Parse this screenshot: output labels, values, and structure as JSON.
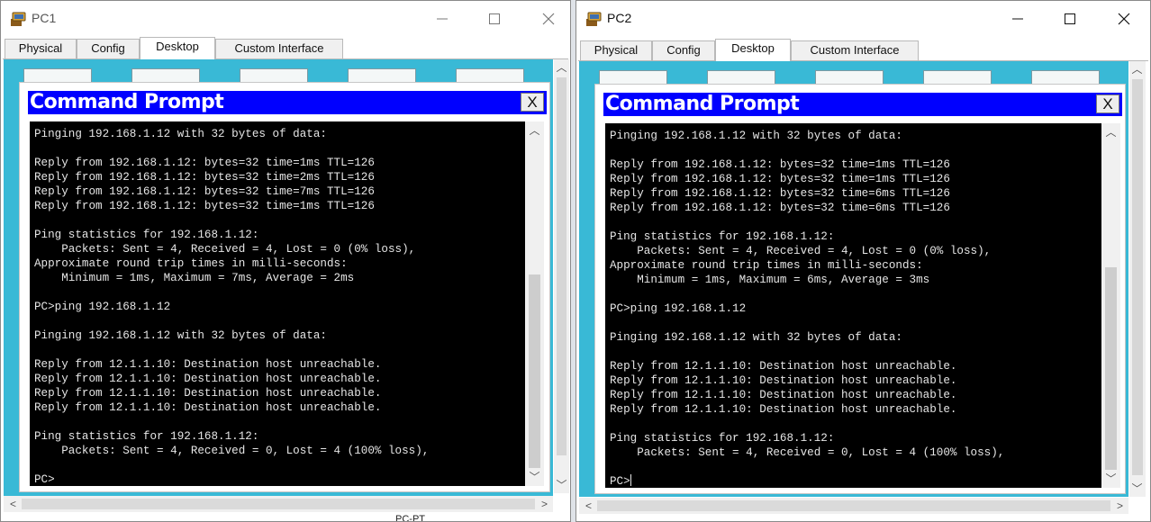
{
  "pc1": {
    "title": "PC1",
    "tabs": [
      "Physical",
      "Config",
      "Desktop",
      "Custom Interface"
    ],
    "active_tab": "Desktop",
    "cmd_title": "Command Prompt",
    "close_label": "X",
    "terminal_lines": [
      "Pinging 192.168.1.12 with 32 bytes of data:",
      "",
      "Reply from 192.168.1.12: bytes=32 time=1ms TTL=126",
      "Reply from 192.168.1.12: bytes=32 time=2ms TTL=126",
      "Reply from 192.168.1.12: bytes=32 time=7ms TTL=126",
      "Reply from 192.168.1.12: bytes=32 time=1ms TTL=126",
      "",
      "Ping statistics for 192.168.1.12:",
      "    Packets: Sent = 4, Received = 4, Lost = 0 (0% loss),",
      "Approximate round trip times in milli-seconds:",
      "    Minimum = 1ms, Maximum = 7ms, Average = 2ms",
      "",
      "PC>ping 192.168.1.12",
      "",
      "Pinging 192.168.1.12 with 32 bytes of data:",
      "",
      "Reply from 12.1.1.10: Destination host unreachable.",
      "Reply from 12.1.1.10: Destination host unreachable.",
      "Reply from 12.1.1.10: Destination host unreachable.",
      "Reply from 12.1.1.10: Destination host unreachable.",
      "",
      "Ping statistics for 192.168.1.12:",
      "    Packets: Sent = 4, Received = 0, Lost = 4 (100% loss),",
      "",
      "PC>"
    ],
    "partial_footer_text": "PC-PT"
  },
  "pc2": {
    "title": "PC2",
    "tabs": [
      "Physical",
      "Config",
      "Desktop",
      "Custom Interface"
    ],
    "active_tab": "Desktop",
    "cmd_title": "Command Prompt",
    "close_label": "X",
    "terminal_lines": [
      "Pinging 192.168.1.12 with 32 bytes of data:",
      "",
      "Reply from 192.168.1.12: bytes=32 time=1ms TTL=126",
      "Reply from 192.168.1.12: bytes=32 time=1ms TTL=126",
      "Reply from 192.168.1.12: bytes=32 time=6ms TTL=126",
      "Reply from 192.168.1.12: bytes=32 time=6ms TTL=126",
      "",
      "Ping statistics for 192.168.1.12:",
      "    Packets: Sent = 4, Received = 4, Lost = 0 (0% loss),",
      "Approximate round trip times in milli-seconds:",
      "    Minimum = 1ms, Maximum = 6ms, Average = 3ms",
      "",
      "PC>ping 192.168.1.12",
      "",
      "Pinging 192.168.1.12 with 32 bytes of data:",
      "",
      "Reply from 12.1.1.10: Destination host unreachable.",
      "Reply from 12.1.1.10: Destination host unreachable.",
      "Reply from 12.1.1.10: Destination host unreachable.",
      "Reply from 12.1.1.10: Destination host unreachable.",
      "",
      "Ping statistics for 192.168.1.12:",
      "    Packets: Sent = 4, Received = 0, Lost = 4 (100% loss),",
      "",
      "PC>"
    ]
  },
  "colors": {
    "desktop_bg": "#39b9d6",
    "cmd_titlebar": "#0000ff",
    "terminal_bg": "#000000",
    "terminal_text": "#e6e6e6"
  }
}
